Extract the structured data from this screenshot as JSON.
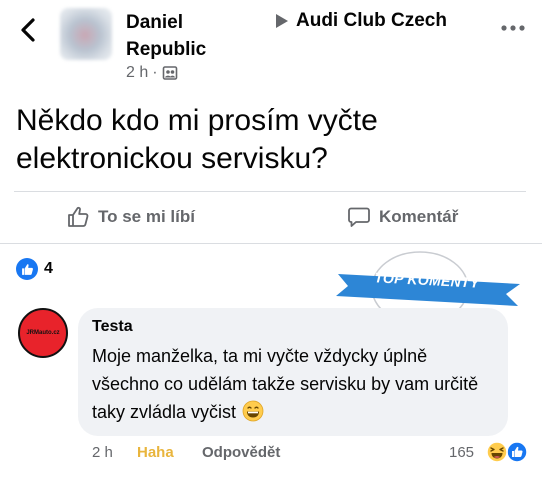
{
  "header": {
    "author": "Daniel Republic",
    "group": "Audi Club Czech",
    "time": "2 h",
    "privacy_icon": "group-members-icon"
  },
  "post": {
    "text": "Někdo kdo mi prosím vyčte elektronickou servisku?"
  },
  "actions": {
    "like_label": "To se mi líbí",
    "comment_label": "Komentář"
  },
  "reactions": {
    "count": "4"
  },
  "sticker": {
    "label": "TOP KOMENTY"
  },
  "comment": {
    "author": "Testa",
    "avatar_text": "JRMauto.cz",
    "text": "Moje manželka, ta mi vyčte vždycky úplně všechno co udělám takže servisku by vam určitě taky zvládla vyčist",
    "time": "2 h",
    "haha_label": "Haha",
    "reply_label": "Odpovědět",
    "reaction_count": "165"
  },
  "colors": {
    "facebook_blue": "#1877f2",
    "haha_yellow": "#e9b53d",
    "secondary_text": "#65676b",
    "bubble_bg": "#f0f2f5",
    "sticker_blue": "#2d86d6"
  }
}
